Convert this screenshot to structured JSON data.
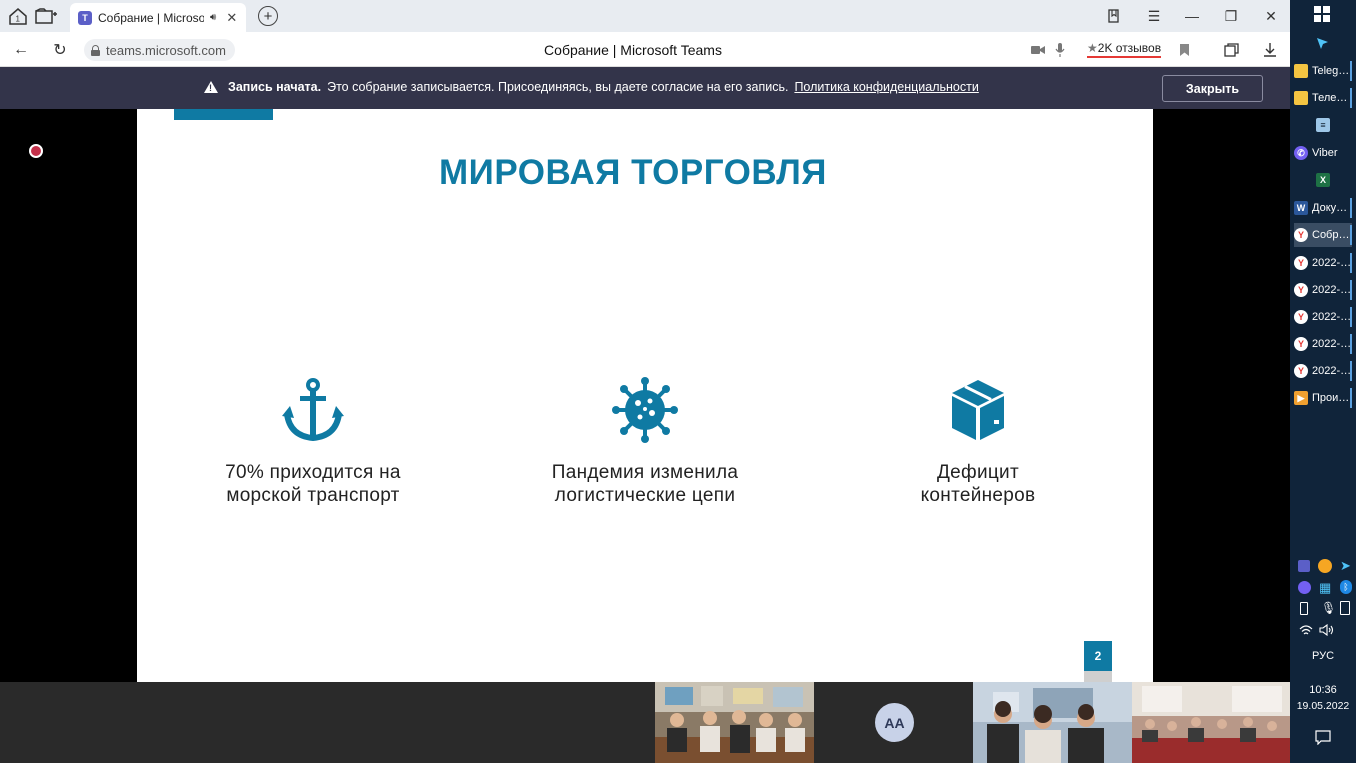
{
  "browser": {
    "tab_title": "Собрание | Microsoft Teams",
    "url": "teams.microsoft.com",
    "page_title": "Собрание | Microsoft Teams",
    "reviews": "2K отзывов"
  },
  "banner": {
    "bold": "Запись начата.",
    "message": " Это собрание записывается. Присоединяясь, вы даете согласие на его запись. ",
    "link": "Политика конфиденциальности",
    "close_label": "Закрыть"
  },
  "slide": {
    "title": "МИРОВАЯ ТОРГОВЛЯ",
    "features": [
      {
        "icon": "anchor-icon",
        "line1": "70% приходится на",
        "line2": "морской транспорт"
      },
      {
        "icon": "virus-icon",
        "line1": "Пандемия изменила",
        "line2": "логистические цепи"
      },
      {
        "icon": "container-box-icon",
        "line1": "Дефицит",
        "line2": "контейнеров"
      }
    ],
    "page_number": "2",
    "accent_color": "#0f7aa3"
  },
  "participants": {
    "avatar_initials": "AA"
  },
  "taskbar": {
    "items": [
      {
        "label": "Teleg…",
        "icon": "folder-icon"
      },
      {
        "label": "Теле…",
        "icon": "folder-icon"
      },
      {
        "label": "",
        "icon": "notepad-icon"
      },
      {
        "label": "Viber",
        "icon": "viber-icon"
      },
      {
        "label": "",
        "icon": "excel-icon"
      },
      {
        "label": "Доку…",
        "icon": "word-icon"
      },
      {
        "label": "Собр…",
        "icon": "yandex-browser-icon"
      },
      {
        "label": "2022-…",
        "icon": "yandex-browser-icon"
      },
      {
        "label": "2022-…",
        "icon": "yandex-browser-icon"
      },
      {
        "label": "2022-…",
        "icon": "yandex-browser-icon"
      },
      {
        "label": "2022-…",
        "icon": "yandex-browser-icon"
      },
      {
        "label": "2022-…",
        "icon": "yandex-browser-icon"
      },
      {
        "label": "Прои…",
        "icon": "media-player-icon"
      }
    ],
    "language": "РУС",
    "time": "10:36",
    "date": "19.05.2022"
  }
}
